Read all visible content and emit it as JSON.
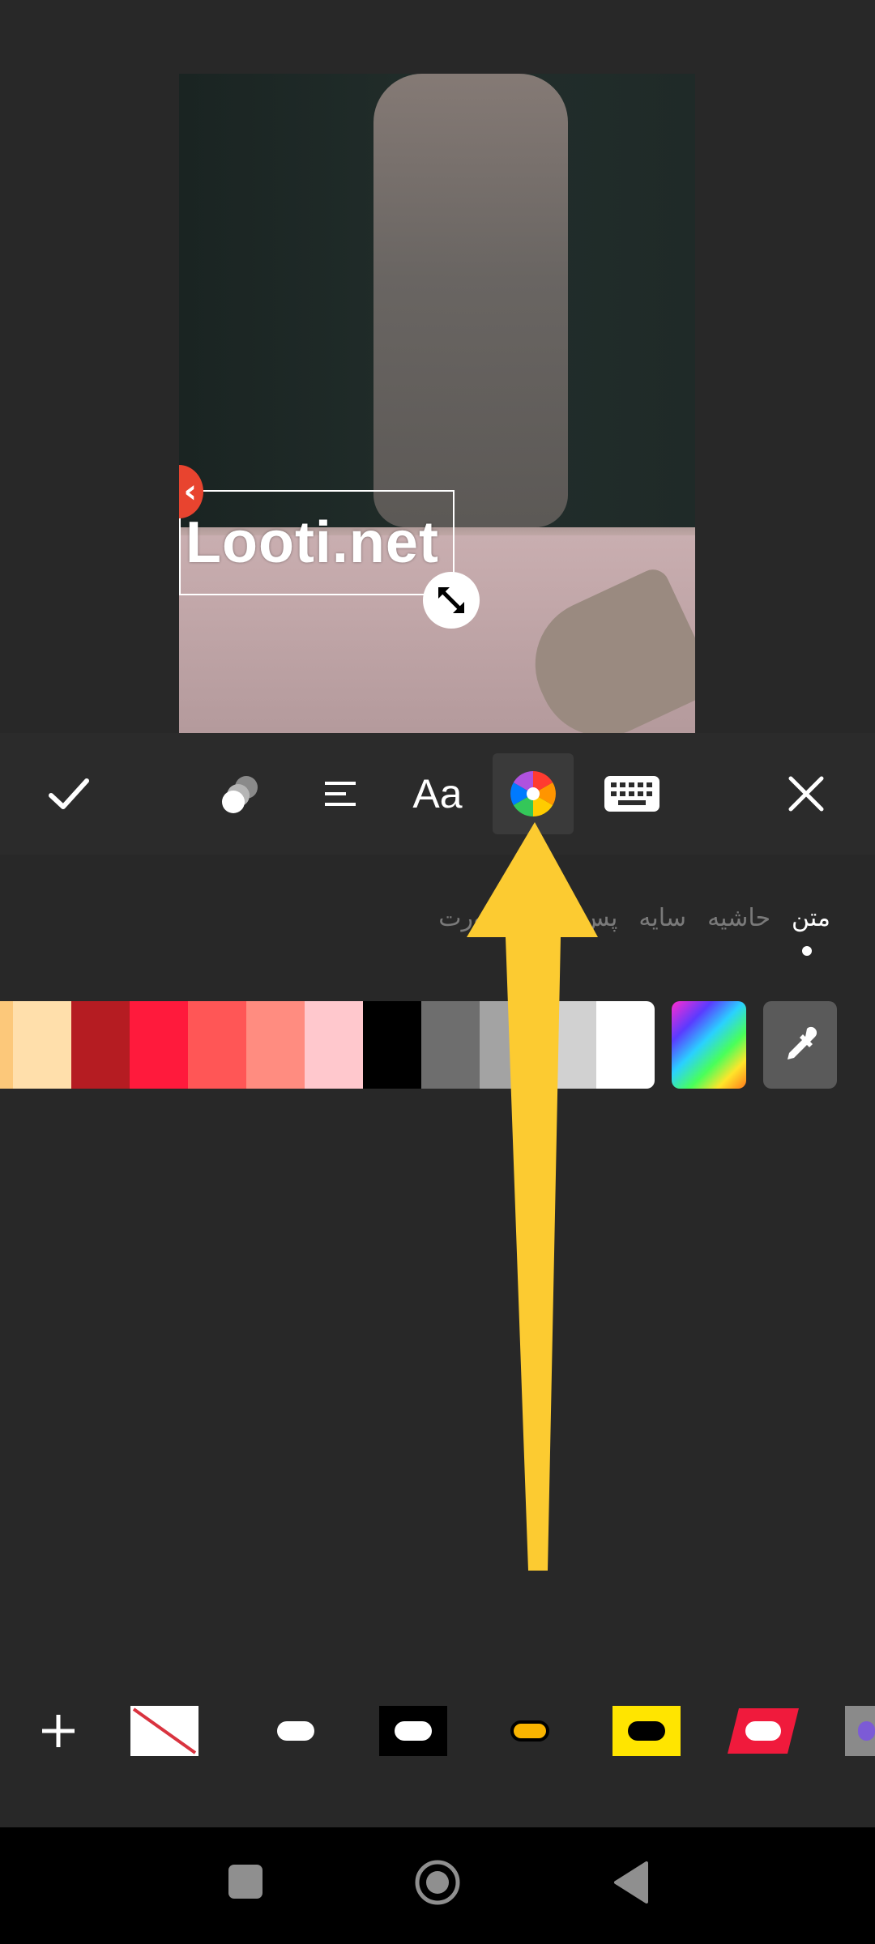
{
  "preview": {
    "overlay_text": "Looti.net"
  },
  "toolbar": {
    "tools": [
      "confirm-check-icon",
      "opacity-icon",
      "align-left-icon",
      "font-icon",
      "color-wheel-icon",
      "keyboard-icon",
      "close-icon"
    ],
    "font_label": "Aa",
    "selected_tool": "color"
  },
  "subtabs": {
    "items": [
      {
        "label": "متن",
        "active": true
      },
      {
        "label": "حاشیه",
        "active": false
      },
      {
        "label": "سایه",
        "active": false
      },
      {
        "label": "پس‌زمینه",
        "active": false
      },
      {
        "label": "صورت",
        "active": false
      }
    ]
  },
  "palette": {
    "colors": [
      "#fcc87a",
      "#ffdfab",
      "#b51c22",
      "#ff1a3c",
      "#ff5656",
      "#ff8c80",
      "#ffc8cd",
      "#000000",
      "#6e6e6e",
      "#a3a3a3",
      "#d1d1d1",
      "#ffffff"
    ],
    "extra": [
      "gradient-picker",
      "eyedropper-icon"
    ]
  },
  "presets": {
    "items": [
      "add-icon",
      "none",
      "white-pill",
      "black-box-white-pill",
      "yellow-outline-pill",
      "yellow-box-black-pill",
      "red-parallelogram",
      "gray-partial"
    ]
  },
  "annotation": {
    "arrow_color": "#fccb31"
  },
  "navbar": {
    "buttons": [
      "recents-square-icon",
      "home-circle-icon",
      "back-triangle-icon"
    ]
  }
}
